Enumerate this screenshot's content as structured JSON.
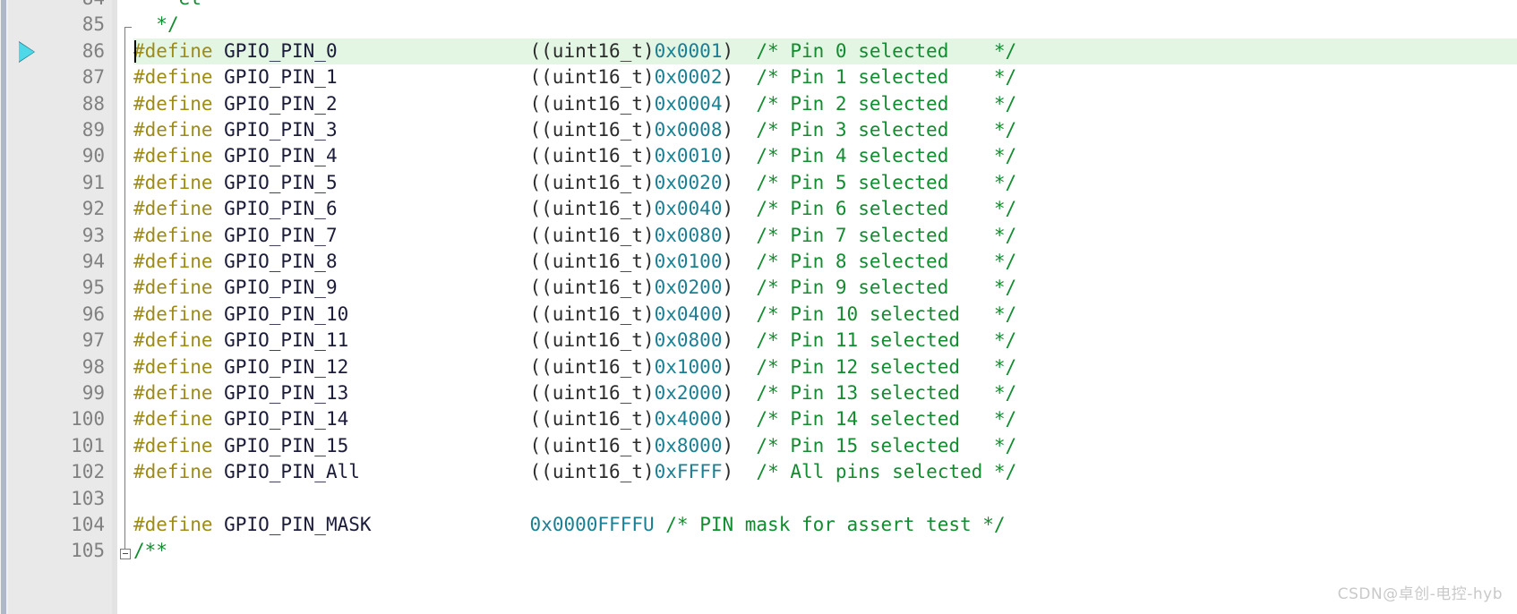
{
  "editor": {
    "kind": "c-source-code-editor",
    "font_size_px": 21,
    "line_height_px": 29.4,
    "colors": {
      "background": "#ffffff",
      "gutter_background": "#e9e9e9",
      "line_number": "#808080",
      "current_line_highlight": "#e3f5e3",
      "preprocessor": "#9d8b17",
      "identifier": "#1b1b3a",
      "punctuation": "#2c2c2c",
      "number": "#1b7f93",
      "comment": "#118c2f",
      "marker_arrow": "#4fd8e8",
      "fold_line": "#7b7b7b",
      "scroll_rail": "#aeb8c6"
    }
  },
  "gutter": {
    "execution_marker_line": 86,
    "execution_marker_icon": "execution-pointer-triangle-icon",
    "fold_collapse_icon": "fold-collapse-minus-box-icon",
    "fold_collapse_line": 105
  },
  "caret": {
    "line": 86,
    "column": 1
  },
  "lines": [
    {
      "number": "84",
      "clipped": true,
      "highlighted": false,
      "tokens": [
        {
          "text": "    ",
          "cls": "t-plain"
        },
        {
          "text": "et",
          "cls": "t-cmt"
        }
      ]
    },
    {
      "number": "85",
      "clipped": false,
      "highlighted": false,
      "tokens": [
        {
          "text": "  ",
          "cls": "t-plain"
        },
        {
          "text": "*/",
          "cls": "t-cmt"
        }
      ]
    },
    {
      "number": "86",
      "clipped": false,
      "highlighted": true,
      "tokens": [
        {
          "text": "#define",
          "cls": "t-pp"
        },
        {
          "text": " GPIO_PIN_0",
          "cls": "t-id"
        },
        {
          "text": "                 ((uint16_t)",
          "cls": "t-plain"
        },
        {
          "text": "0x0001",
          "cls": "t-num"
        },
        {
          "text": ")",
          "cls": "t-plain"
        },
        {
          "text": "  /* Pin 0 selected    */",
          "cls": "t-cmt"
        }
      ]
    },
    {
      "number": "87",
      "clipped": false,
      "highlighted": false,
      "tokens": [
        {
          "text": "#define",
          "cls": "t-pp"
        },
        {
          "text": " GPIO_PIN_1",
          "cls": "t-id"
        },
        {
          "text": "                 ((uint16_t)",
          "cls": "t-plain"
        },
        {
          "text": "0x0002",
          "cls": "t-num"
        },
        {
          "text": ")",
          "cls": "t-plain"
        },
        {
          "text": "  /* Pin 1 selected    */",
          "cls": "t-cmt"
        }
      ]
    },
    {
      "number": "88",
      "clipped": false,
      "highlighted": false,
      "tokens": [
        {
          "text": "#define",
          "cls": "t-pp"
        },
        {
          "text": " GPIO_PIN_2",
          "cls": "t-id"
        },
        {
          "text": "                 ((uint16_t)",
          "cls": "t-plain"
        },
        {
          "text": "0x0004",
          "cls": "t-num"
        },
        {
          "text": ")",
          "cls": "t-plain"
        },
        {
          "text": "  /* Pin 2 selected    */",
          "cls": "t-cmt"
        }
      ]
    },
    {
      "number": "89",
      "clipped": false,
      "highlighted": false,
      "tokens": [
        {
          "text": "#define",
          "cls": "t-pp"
        },
        {
          "text": " GPIO_PIN_3",
          "cls": "t-id"
        },
        {
          "text": "                 ((uint16_t)",
          "cls": "t-plain"
        },
        {
          "text": "0x0008",
          "cls": "t-num"
        },
        {
          "text": ")",
          "cls": "t-plain"
        },
        {
          "text": "  /* Pin 3 selected    */",
          "cls": "t-cmt"
        }
      ]
    },
    {
      "number": "90",
      "clipped": false,
      "highlighted": false,
      "tokens": [
        {
          "text": "#define",
          "cls": "t-pp"
        },
        {
          "text": " GPIO_PIN_4",
          "cls": "t-id"
        },
        {
          "text": "                 ((uint16_t)",
          "cls": "t-plain"
        },
        {
          "text": "0x0010",
          "cls": "t-num"
        },
        {
          "text": ")",
          "cls": "t-plain"
        },
        {
          "text": "  /* Pin 4 selected    */",
          "cls": "t-cmt"
        }
      ]
    },
    {
      "number": "91",
      "clipped": false,
      "highlighted": false,
      "tokens": [
        {
          "text": "#define",
          "cls": "t-pp"
        },
        {
          "text": " GPIO_PIN_5",
          "cls": "t-id"
        },
        {
          "text": "                 ((uint16_t)",
          "cls": "t-plain"
        },
        {
          "text": "0x0020",
          "cls": "t-num"
        },
        {
          "text": ")",
          "cls": "t-plain"
        },
        {
          "text": "  /* Pin 5 selected    */",
          "cls": "t-cmt"
        }
      ]
    },
    {
      "number": "92",
      "clipped": false,
      "highlighted": false,
      "tokens": [
        {
          "text": "#define",
          "cls": "t-pp"
        },
        {
          "text": " GPIO_PIN_6",
          "cls": "t-id"
        },
        {
          "text": "                 ((uint16_t)",
          "cls": "t-plain"
        },
        {
          "text": "0x0040",
          "cls": "t-num"
        },
        {
          "text": ")",
          "cls": "t-plain"
        },
        {
          "text": "  /* Pin 6 selected    */",
          "cls": "t-cmt"
        }
      ]
    },
    {
      "number": "93",
      "clipped": false,
      "highlighted": false,
      "tokens": [
        {
          "text": "#define",
          "cls": "t-pp"
        },
        {
          "text": " GPIO_PIN_7",
          "cls": "t-id"
        },
        {
          "text": "                 ((uint16_t)",
          "cls": "t-plain"
        },
        {
          "text": "0x0080",
          "cls": "t-num"
        },
        {
          "text": ")",
          "cls": "t-plain"
        },
        {
          "text": "  /* Pin 7 selected    */",
          "cls": "t-cmt"
        }
      ]
    },
    {
      "number": "94",
      "clipped": false,
      "highlighted": false,
      "tokens": [
        {
          "text": "#define",
          "cls": "t-pp"
        },
        {
          "text": " GPIO_PIN_8",
          "cls": "t-id"
        },
        {
          "text": "                 ((uint16_t)",
          "cls": "t-plain"
        },
        {
          "text": "0x0100",
          "cls": "t-num"
        },
        {
          "text": ")",
          "cls": "t-plain"
        },
        {
          "text": "  /* Pin 8 selected    */",
          "cls": "t-cmt"
        }
      ]
    },
    {
      "number": "95",
      "clipped": false,
      "highlighted": false,
      "tokens": [
        {
          "text": "#define",
          "cls": "t-pp"
        },
        {
          "text": " GPIO_PIN_9",
          "cls": "t-id"
        },
        {
          "text": "                 ((uint16_t)",
          "cls": "t-plain"
        },
        {
          "text": "0x0200",
          "cls": "t-num"
        },
        {
          "text": ")",
          "cls": "t-plain"
        },
        {
          "text": "  /* Pin 9 selected    */",
          "cls": "t-cmt"
        }
      ]
    },
    {
      "number": "96",
      "clipped": false,
      "highlighted": false,
      "tokens": [
        {
          "text": "#define",
          "cls": "t-pp"
        },
        {
          "text": " GPIO_PIN_10",
          "cls": "t-id"
        },
        {
          "text": "                ((uint16_t)",
          "cls": "t-plain"
        },
        {
          "text": "0x0400",
          "cls": "t-num"
        },
        {
          "text": ")",
          "cls": "t-plain"
        },
        {
          "text": "  /* Pin 10 selected   */",
          "cls": "t-cmt"
        }
      ]
    },
    {
      "number": "97",
      "clipped": false,
      "highlighted": false,
      "tokens": [
        {
          "text": "#define",
          "cls": "t-pp"
        },
        {
          "text": " GPIO_PIN_11",
          "cls": "t-id"
        },
        {
          "text": "                ((uint16_t)",
          "cls": "t-plain"
        },
        {
          "text": "0x0800",
          "cls": "t-num"
        },
        {
          "text": ")",
          "cls": "t-plain"
        },
        {
          "text": "  /* Pin 11 selected   */",
          "cls": "t-cmt"
        }
      ]
    },
    {
      "number": "98",
      "clipped": false,
      "highlighted": false,
      "tokens": [
        {
          "text": "#define",
          "cls": "t-pp"
        },
        {
          "text": " GPIO_PIN_12",
          "cls": "t-id"
        },
        {
          "text": "                ((uint16_t)",
          "cls": "t-plain"
        },
        {
          "text": "0x1000",
          "cls": "t-num"
        },
        {
          "text": ")",
          "cls": "t-plain"
        },
        {
          "text": "  /* Pin 12 selected   */",
          "cls": "t-cmt"
        }
      ]
    },
    {
      "number": "99",
      "clipped": false,
      "highlighted": false,
      "tokens": [
        {
          "text": "#define",
          "cls": "t-pp"
        },
        {
          "text": " GPIO_PIN_13",
          "cls": "t-id"
        },
        {
          "text": "                ((uint16_t)",
          "cls": "t-plain"
        },
        {
          "text": "0x2000",
          "cls": "t-num"
        },
        {
          "text": ")",
          "cls": "t-plain"
        },
        {
          "text": "  /* Pin 13 selected   */",
          "cls": "t-cmt"
        }
      ]
    },
    {
      "number": "100",
      "clipped": false,
      "highlighted": false,
      "tokens": [
        {
          "text": "#define",
          "cls": "t-pp"
        },
        {
          "text": " GPIO_PIN_14",
          "cls": "t-id"
        },
        {
          "text": "                ((uint16_t)",
          "cls": "t-plain"
        },
        {
          "text": "0x4000",
          "cls": "t-num"
        },
        {
          "text": ")",
          "cls": "t-plain"
        },
        {
          "text": "  /* Pin 14 selected   */",
          "cls": "t-cmt"
        }
      ]
    },
    {
      "number": "101",
      "clipped": false,
      "highlighted": false,
      "tokens": [
        {
          "text": "#define",
          "cls": "t-pp"
        },
        {
          "text": " GPIO_PIN_15",
          "cls": "t-id"
        },
        {
          "text": "                ((uint16_t)",
          "cls": "t-plain"
        },
        {
          "text": "0x8000",
          "cls": "t-num"
        },
        {
          "text": ")",
          "cls": "t-plain"
        },
        {
          "text": "  /* Pin 15 selected   */",
          "cls": "t-cmt"
        }
      ]
    },
    {
      "number": "102",
      "clipped": false,
      "highlighted": false,
      "tokens": [
        {
          "text": "#define",
          "cls": "t-pp"
        },
        {
          "text": " GPIO_PIN_All",
          "cls": "t-id"
        },
        {
          "text": "               ((uint16_t)",
          "cls": "t-plain"
        },
        {
          "text": "0xFFFF",
          "cls": "t-num"
        },
        {
          "text": ")",
          "cls": "t-plain"
        },
        {
          "text": "  /* All pins selected */",
          "cls": "t-cmt"
        }
      ]
    },
    {
      "number": "103",
      "clipped": false,
      "highlighted": false,
      "tokens": []
    },
    {
      "number": "104",
      "clipped": false,
      "highlighted": false,
      "tokens": [
        {
          "text": "#define",
          "cls": "t-pp"
        },
        {
          "text": " GPIO_PIN_MASK",
          "cls": "t-id"
        },
        {
          "text": "              ",
          "cls": "t-plain"
        },
        {
          "text": "0x0000FFFFU",
          "cls": "t-num"
        },
        {
          "text": " /* PIN mask for assert test */",
          "cls": "t-cmt"
        }
      ]
    },
    {
      "number": "105",
      "clipped": true,
      "highlighted": false,
      "tokens": [
        {
          "text": "/**",
          "cls": "t-cmt"
        }
      ]
    }
  ],
  "watermark": {
    "text": "CSDN@卓创-电控-hyb"
  }
}
